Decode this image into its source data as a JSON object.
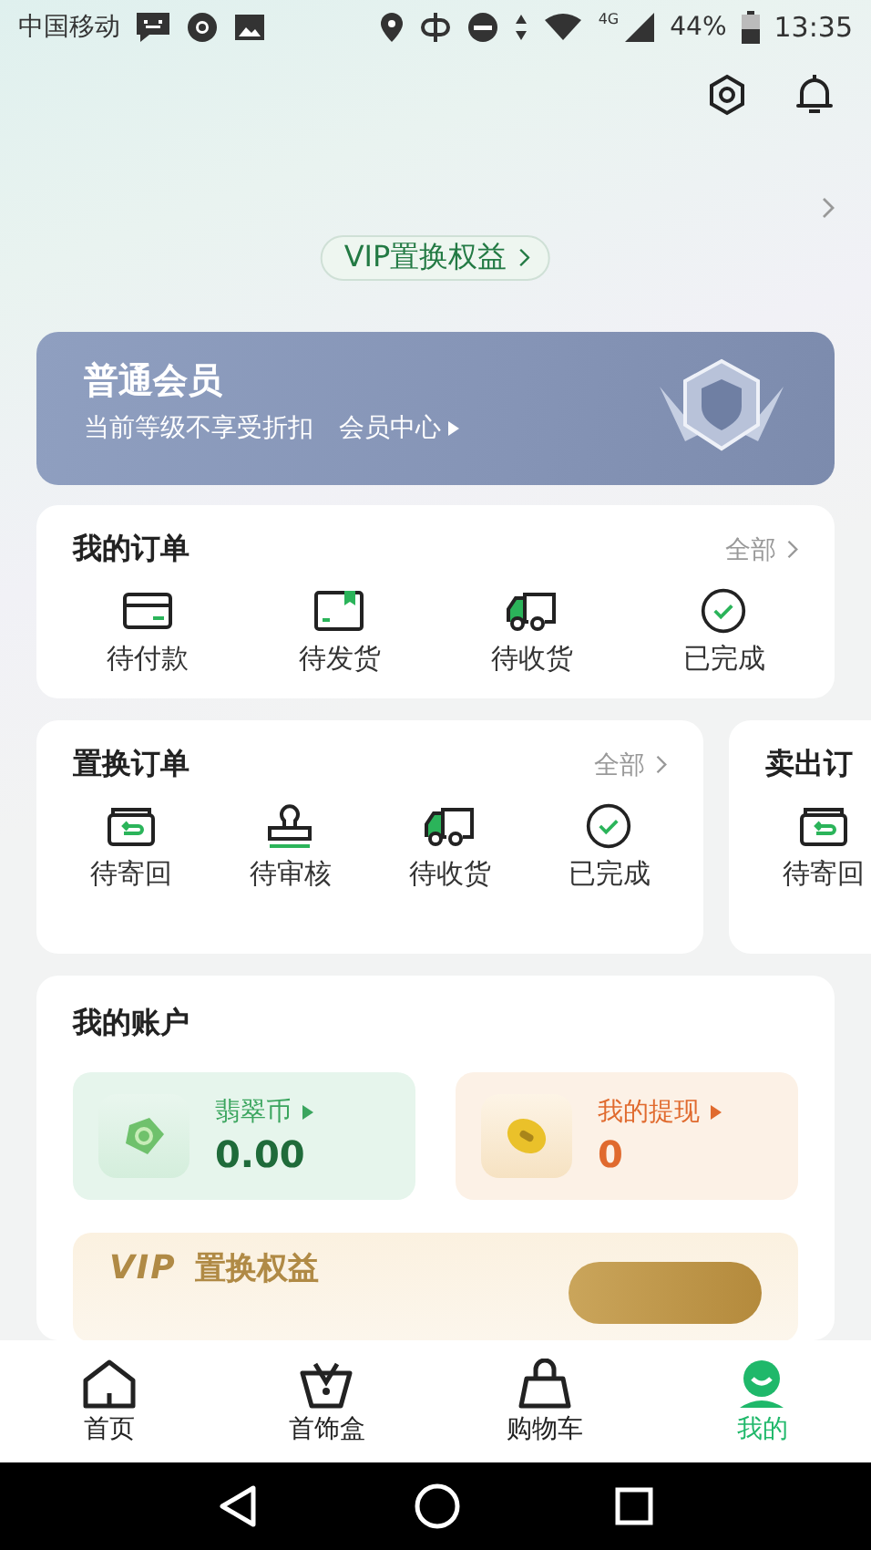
{
  "status_bar": {
    "carrier": "中国移动",
    "network": "4G",
    "battery": "44%",
    "time": "13:35"
  },
  "header": {
    "vip_link": "VIP置换权益"
  },
  "member": {
    "level": "普通会员",
    "desc": "当前等级不享受折扣",
    "link": "会员中心"
  },
  "orders": [
    {
      "title": "我的订单",
      "all": "全部",
      "items": [
        {
          "kind": "card",
          "label": "待付款"
        },
        {
          "kind": "box",
          "label": "待发货"
        },
        {
          "kind": "truck",
          "label": "待收货"
        },
        {
          "kind": "check",
          "label": "已完成"
        }
      ]
    },
    {
      "title": "置换订单",
      "all": "全部",
      "items": [
        {
          "kind": "return",
          "label": "待寄回"
        },
        {
          "kind": "stamp",
          "label": "待审核"
        },
        {
          "kind": "truck",
          "label": "待收货"
        },
        {
          "kind": "check",
          "label": "已完成"
        }
      ]
    },
    {
      "title": "卖出订",
      "items": [
        {
          "kind": "return",
          "label": "待寄回"
        }
      ]
    }
  ],
  "account": {
    "title": "我的账户",
    "wallets": [
      {
        "kind": "jade",
        "name": "翡翠币",
        "value": "0.00"
      },
      {
        "kind": "withdraw",
        "name": "我的提现",
        "value": "0"
      }
    ],
    "vip": {
      "brand": "VIP",
      "label": "置换权益"
    }
  },
  "tabs": [
    {
      "kind": "home",
      "label": "首页",
      "selected": false
    },
    {
      "kind": "jewel",
      "label": "首饰盒",
      "selected": false
    },
    {
      "kind": "bag",
      "label": "购物车",
      "selected": false
    },
    {
      "kind": "me",
      "label": "我的",
      "selected": true
    }
  ]
}
